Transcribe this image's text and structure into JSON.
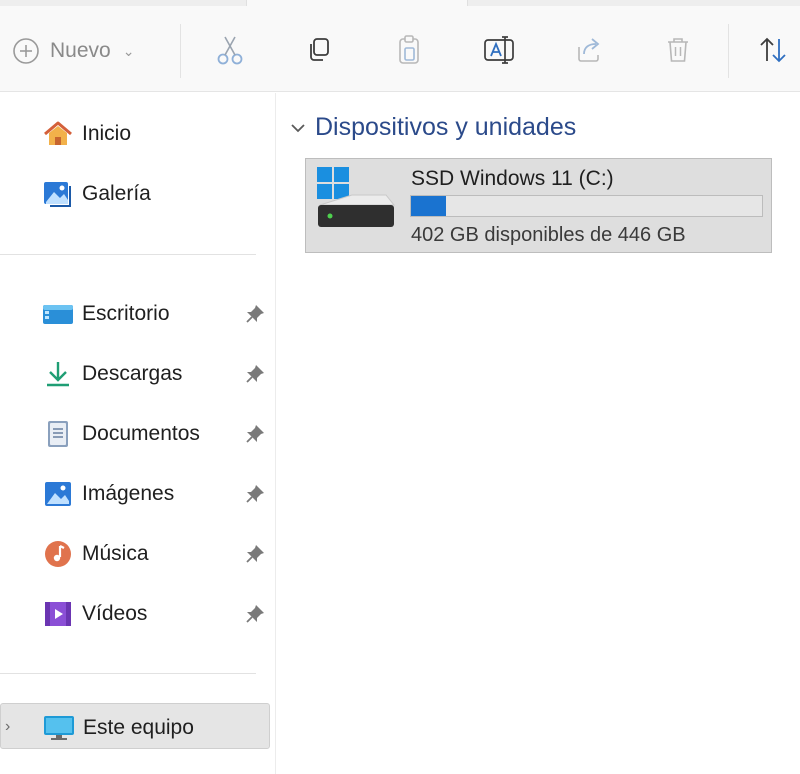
{
  "toolbar": {
    "new_label": "Nuevo",
    "buttons": [
      {
        "name": "cut-button",
        "icon": "scissors-icon"
      },
      {
        "name": "copy-button",
        "icon": "copy-icon"
      },
      {
        "name": "paste-button",
        "icon": "paste-icon"
      },
      {
        "name": "rename-button",
        "icon": "rename-icon"
      },
      {
        "name": "share-button",
        "icon": "share-icon"
      },
      {
        "name": "delete-button",
        "icon": "trash-icon"
      },
      {
        "name": "sort-button",
        "icon": "sort-icon"
      }
    ]
  },
  "sidebar": {
    "items": [
      {
        "label": "Inicio",
        "icon": "home-icon",
        "pinned": false
      },
      {
        "label": "Galería",
        "icon": "gallery-icon",
        "pinned": false
      },
      {
        "label": "Escritorio",
        "icon": "desktop-icon",
        "pinned": true
      },
      {
        "label": "Descargas",
        "icon": "download-icon",
        "pinned": true
      },
      {
        "label": "Documentos",
        "icon": "document-icon",
        "pinned": true
      },
      {
        "label": "Imágenes",
        "icon": "pictures-icon",
        "pinned": true
      },
      {
        "label": "Música",
        "icon": "music-icon",
        "pinned": true
      },
      {
        "label": "Vídeos",
        "icon": "video-icon",
        "pinned": true
      },
      {
        "label": "Este equipo",
        "icon": "this-pc-icon",
        "pinned": false,
        "selected": true
      }
    ]
  },
  "main": {
    "group_title": "Dispositivos y unidades",
    "drive": {
      "name": "SSD Windows 11 (C:)",
      "space_text": "402 GB disponibles de 446 GB",
      "used_fraction": 0.099
    }
  },
  "colors": {
    "accent": "#1a73d0",
    "group_header": "#2b4a8a",
    "selected_bg": "#e5e5e5"
  }
}
